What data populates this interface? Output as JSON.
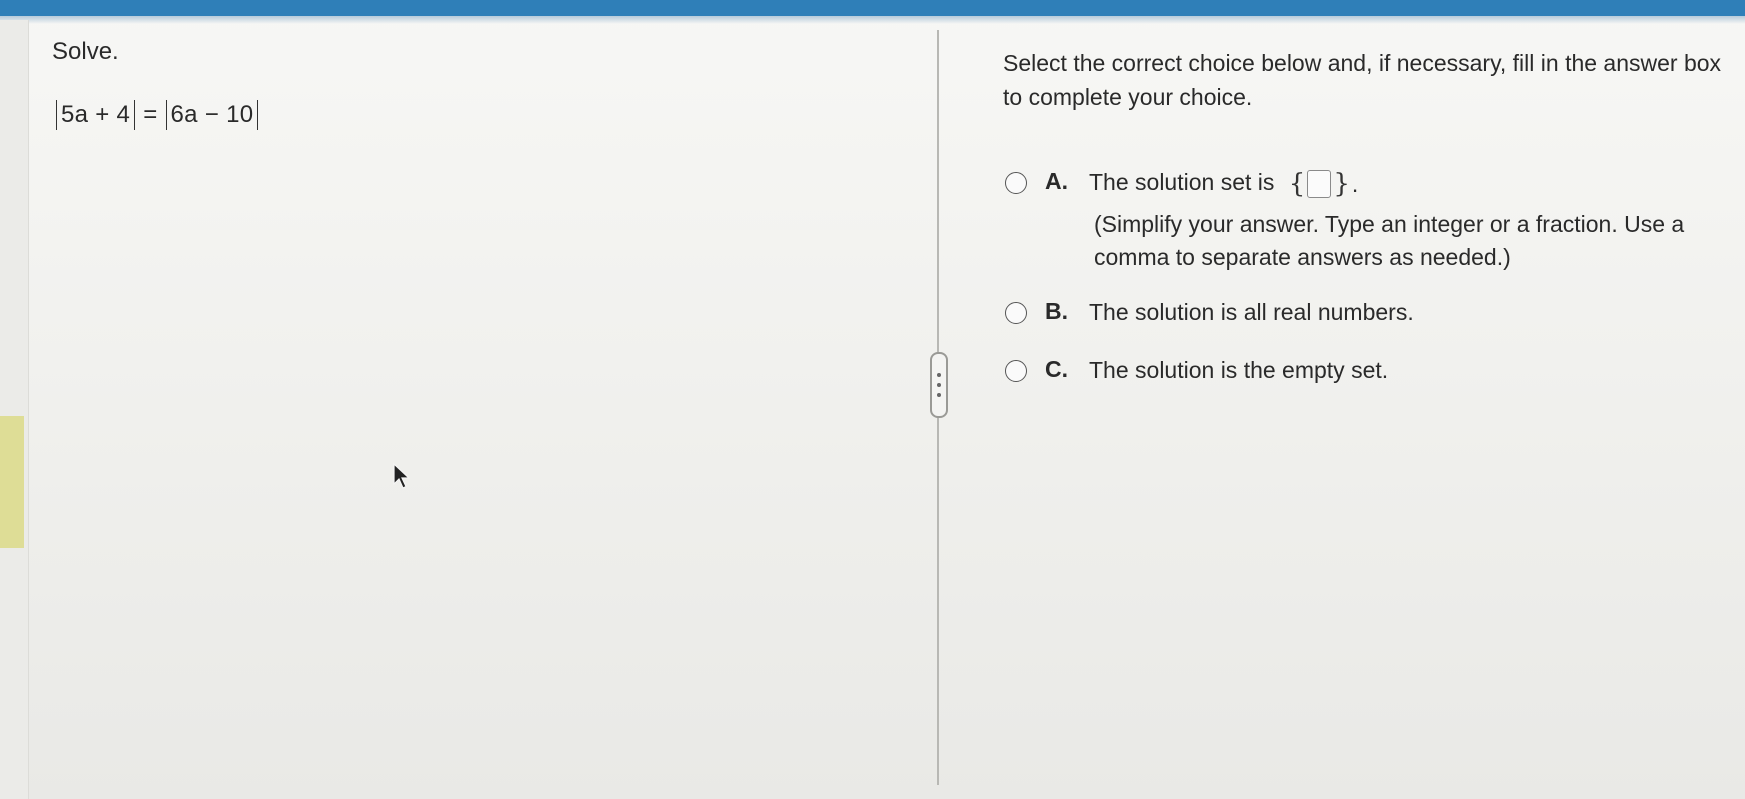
{
  "colors": {
    "top_bar": "#2f7fb8",
    "text": "#2a2a2a",
    "left_accent": "#dedd96"
  },
  "question": {
    "label": "Solve.",
    "equation": {
      "left_abs": "5a + 4",
      "equals": "=",
      "right_abs": "6a − 10"
    }
  },
  "instruction": "Select the correct choice below and, if necessary, fill in the answer box to complete your choice.",
  "choices": [
    {
      "letter": "A.",
      "text": "The solution set is",
      "set_open": "{",
      "set_close": "}",
      "after": ".",
      "hint": "(Simplify your answer. Type an integer or a fraction. Use a comma to separate answers as needed.)"
    },
    {
      "letter": "B.",
      "text": "The solution is all real numbers."
    },
    {
      "letter": "C.",
      "text": "The solution is the empty set."
    }
  ],
  "icons": {
    "divider_handle": "vertical-ellipsis-icon",
    "cursor": "mouse-pointer-icon"
  }
}
